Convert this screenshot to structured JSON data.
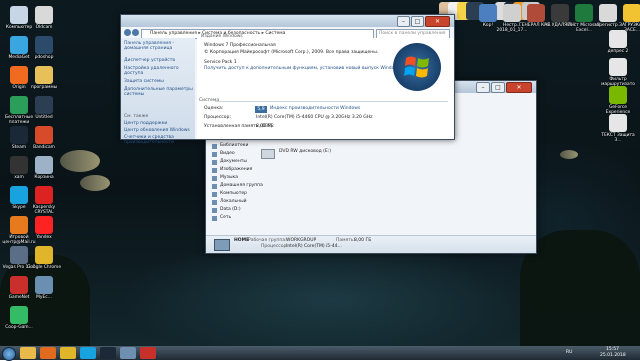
{
  "desktop": {
    "left_icons": [
      {
        "label": "Компьютер",
        "color": "#c7d6e6"
      },
      {
        "label": "Oldcam",
        "color": "#d9d9d9"
      },
      {
        "label": "MediaGet",
        "color": "#3aa6e0"
      },
      {
        "label": "pdoshop",
        "color": "#2c4a6a"
      },
      {
        "label": "Origin",
        "color": "#f06b1f"
      },
      {
        "label": "программы",
        "color": "#e8c05a"
      },
      {
        "label": "Бесплатные платежи",
        "color": "#2b9f5a"
      },
      {
        "label": "Untitled",
        "color": "#2b3e52"
      },
      {
        "label": "Steam",
        "color": "#1b2838"
      },
      {
        "label": "Bandicam",
        "color": "#d84b2a"
      },
      {
        "label": "xam",
        "color": "#333"
      },
      {
        "label": "Корзина",
        "color": "#9db2c6"
      },
      {
        "label": "Skype",
        "color": "#18a2e0"
      },
      {
        "label": "Kaspersky CRYSTAL",
        "color": "#d22"
      },
      {
        "label": "Игровой центр@Mail.ru",
        "color": "#e87a1e"
      },
      {
        "label": "Yandex",
        "color": "#f22"
      },
      {
        "label": "Vegas Pro 11.0",
        "color": "#5a6f86"
      },
      {
        "label": "Google Chrome",
        "color": "#e0b52a"
      },
      {
        "label": "GameNet",
        "color": "#c9302c"
      },
      {
        "label": "MyEc...",
        "color": "#6b8fb0"
      },
      {
        "label": "Coop-Gam...",
        "color": "#3b6"
      }
    ],
    "top_icons": [
      {
        "label": "",
        "color": "#e0c2a0"
      },
      {
        "label": "",
        "color": "#f2f2f2"
      },
      {
        "label": "",
        "color": "#f7d34a"
      },
      {
        "label": "",
        "color": "#2b3e52"
      },
      {
        "label": "",
        "color": "#dddddd"
      },
      {
        "label": "",
        "color": "#1b2838"
      },
      {
        "label": "",
        "color": "#e89a2a"
      },
      {
        "label": "",
        "color": "#cccccc"
      }
    ],
    "right_icons": [
      {
        "label": "Кор!",
        "color": "#4c7fbf"
      },
      {
        "label": "Нестр... 2018_01_17...",
        "color": "#d0d0d0"
      },
      {
        "label": "ГЕНЕРАЛ КАВ..",
        "color": "#b04b3a"
      },
      {
        "label": "НЕ УДАЛЯЙ!!!",
        "color": "#3a3a3a"
      },
      {
        "label": "Лист Microsoft Excel...",
        "color": "#1f7a3d"
      },
      {
        "label": "зарегистр...",
        "color": "#d9d9d9"
      },
      {
        "label": "ЗАГРУЗКА - ЗАСЕ...",
        "color": "#f1c232"
      },
      {
        "label": "депрес 2",
        "color": "#e6e6e6"
      },
      {
        "label": "Фильтр маршрутизатора...",
        "color": "#e6e6e6"
      },
      {
        "label": "GeForce Experience",
        "color": "#7ab800"
      },
      {
        "label": "ТЕКСТ Защита З...",
        "color": "#e6e6e6"
      }
    ]
  },
  "system_window": {
    "address_parts": [
      "Панель управления",
      "Система и безопасность",
      "Система"
    ],
    "search_placeholder": "Поиск в панели управления",
    "sidebar": {
      "home": "Панель управления - домашняя страница",
      "links": [
        "Диспетчер устройств",
        "Настройка удаленного доступа",
        "Защита системы",
        "Дополнительные параметры системы"
      ],
      "see_also": "См. также",
      "see_links": [
        "Центр поддержки",
        "Центр обновления Windows",
        "Счетчики и средства производительности"
      ]
    },
    "cut_heading": "Издание Windows",
    "edition": "Windows 7 Профессиональная",
    "copyright": "© Корпорация Майкрософт (Microsoft Corp.), 2009. Все права защищены.",
    "service_pack": "Service Pack 1",
    "upgrade_link": "Получить доступ к дополнительным функциям, установив новый выпуск Windows 7",
    "system_heading": "Система",
    "rows": [
      {
        "label": "Оценка:",
        "value": "Индекс производительности Windows",
        "is_link": true
      },
      {
        "label": "Процессор:",
        "value": "Intel(R) Core(TM) i5-4460 CPU @ 3.20GHz   3.20 GHz",
        "is_link": false
      },
      {
        "label": "Установленная память (ОЗУ):",
        "value": "8,00 ГБ",
        "is_link": false
      }
    ],
    "score": "5,9"
  },
  "explorer_window": {
    "nav_tree": [
      {
        "label": "Библиотеки",
        "icon": "library-icon"
      },
      {
        "label": "Видео",
        "icon": "video-icon"
      },
      {
        "label": "Документы",
        "icon": "documents-icon"
      },
      {
        "label": "Изображения",
        "icon": "pictures-icon"
      },
      {
        "label": "Музыка",
        "icon": "music-icon"
      },
      {
        "label": "Домашняя группа",
        "icon": "homegroup-icon"
      },
      {
        "label": "Компьютер",
        "icon": "computer-icon"
      },
      {
        "label": "Локальный",
        "icon": "drive-icon"
      },
      {
        "label": "Data (D:)",
        "icon": "drive-icon"
      },
      {
        "label": "Сеть",
        "icon": "network-icon"
      }
    ],
    "dvd_label": "DVD RW дисковод (E:)",
    "details": {
      "name": "HOME",
      "workgroup_label": "Рабочая группа:",
      "workgroup_value": "WORKGROUP",
      "memory_label": "Память:",
      "memory_value": "8,00 ГБ",
      "cpu_label": "Процессор:",
      "cpu_value": "Intel(R) Core(TM) i5-44..."
    }
  },
  "taskbar": {
    "time": "15:57",
    "date": "25.01.2018",
    "lang": "RU",
    "buttons": [
      {
        "name": "explorer-taskbar-button",
        "color": "#e9b949"
      },
      {
        "name": "media-player-taskbar-button",
        "color": "#e06b1f"
      },
      {
        "name": "chrome-taskbar-button",
        "color": "#e0b52a"
      },
      {
        "name": "skype-taskbar-button",
        "color": "#18a2e0"
      },
      {
        "name": "steam-taskbar-button",
        "color": "#1b2838"
      },
      {
        "name": "control-panel-taskbar-button",
        "color": "#6f8fb0"
      },
      {
        "name": "record-taskbar-button",
        "color": "#c8302c"
      }
    ]
  }
}
